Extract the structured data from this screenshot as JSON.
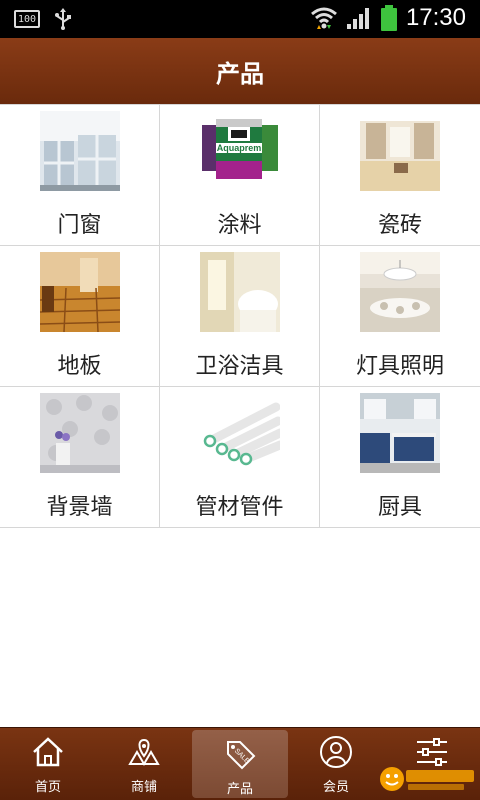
{
  "statusbar": {
    "battery_small": "100",
    "time": "17:30"
  },
  "header": {
    "title": "产品"
  },
  "products": [
    {
      "label": "门窗",
      "icon": "windows-doors-photo"
    },
    {
      "label": "涂料",
      "icon": "paint-cans-photo"
    },
    {
      "label": "瓷砖",
      "icon": "tile-room-photo"
    },
    {
      "label": "地板",
      "icon": "wood-floor-photo"
    },
    {
      "label": "卫浴洁具",
      "icon": "bathroom-photo"
    },
    {
      "label": "灯具照明",
      "icon": "chandelier-photo"
    },
    {
      "label": "背景墙",
      "icon": "wallpaper-photo"
    },
    {
      "label": "管材管件",
      "icon": "pipes-photo"
    },
    {
      "label": "厨具",
      "icon": "kitchen-photo"
    }
  ],
  "paint_brand": "Aquaprem",
  "tabs": [
    {
      "label": "首页",
      "icon": "home-icon",
      "active": false
    },
    {
      "label": "商铺",
      "icon": "map-pin-icon",
      "active": false
    },
    {
      "label": "产品",
      "icon": "sale-tag-icon",
      "active": true
    },
    {
      "label": "会员",
      "icon": "user-icon",
      "active": false
    },
    {
      "label": "",
      "icon": "sliders-icon",
      "active": false
    }
  ],
  "colors": {
    "header": "#7a3412",
    "tabbar": "#6a2a0c",
    "battery": "#3ec43e"
  }
}
